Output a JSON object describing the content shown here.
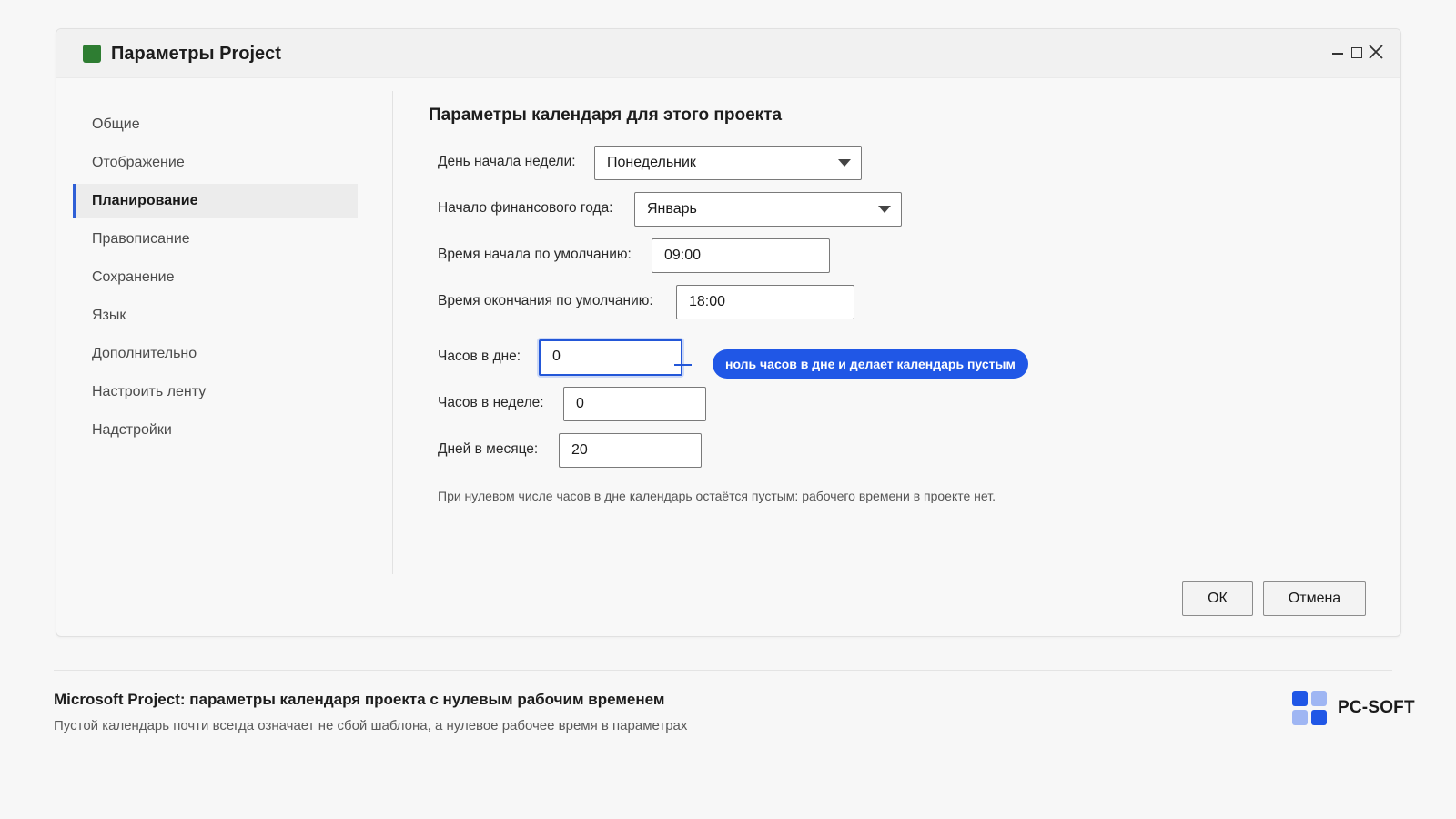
{
  "window": {
    "title": "Параметры Project",
    "icon": "project-app-icon",
    "icon_color": "#2e7d32"
  },
  "sidebar": {
    "items": [
      {
        "label": "Общие"
      },
      {
        "label": "Отображение"
      },
      {
        "label": "Планирование",
        "active": true
      },
      {
        "label": "Правописание"
      },
      {
        "label": "Сохранение"
      },
      {
        "label": "Язык"
      },
      {
        "label": "Дополнительно"
      },
      {
        "label": "Настроить ленту"
      },
      {
        "label": "Надстройки"
      }
    ]
  },
  "main": {
    "section_title": "Параметры календаря для этого проекта",
    "week_start": {
      "label": "День начала недели:",
      "value": "Понедельник"
    },
    "fiscal_year_start": {
      "label": "Начало финансового года:",
      "value": "Январь"
    },
    "default_start_time": {
      "label": "Время начала по умолчанию:",
      "value": "09:00"
    },
    "default_end_time": {
      "label": "Время окончания по умолчанию:",
      "value": "18:00"
    },
    "hours_per_day": {
      "label": "Часов в дне:",
      "value": "0"
    },
    "hours_per_week": {
      "label": "Часов в неделе:",
      "value": "0"
    },
    "days_per_month": {
      "label": "Дней в месяце:",
      "value": "20"
    },
    "callout": "ноль часов в дне и делает календарь пустым",
    "hint": "При нулевом числе часов в дне календарь остаётся пустым: рабочего времени в проекте нет."
  },
  "buttons": {
    "ok": "ОК",
    "cancel": "Отмена"
  },
  "footer": {
    "title": "Microsoft Project: параметры календаря проекта с нулевым рабочим временем",
    "subtitle": "Пустой календарь почти всегда означает не сбой шаблона, а нулевое рабочее время в параметрах",
    "brand": "PC-SOFT"
  },
  "colors": {
    "accent": "#2057e6",
    "focus_border": "#2357d8",
    "active_indicator": "#2f5fd6",
    "logo_dark": "#2057e6",
    "logo_light": "#9fb6f3"
  }
}
